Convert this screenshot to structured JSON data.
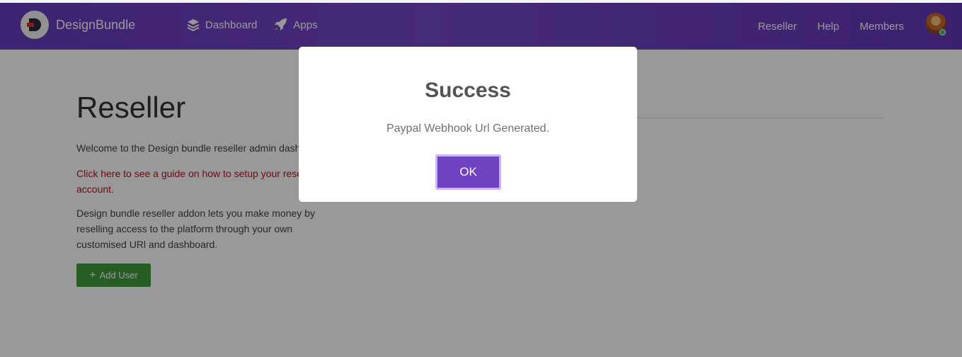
{
  "brand": {
    "name": "DesignBundle"
  },
  "nav": {
    "left": [
      {
        "label": "Dashboard",
        "icon": "layers-icon"
      },
      {
        "label": "Apps",
        "icon": "rocket-icon"
      }
    ],
    "right": [
      "Reseller",
      "Help",
      "Members"
    ]
  },
  "page": {
    "title": "Reseller",
    "welcome": "Welcome to the Design bundle reseller admin dash",
    "guide_link": "Click here to see a guide on how to setup your rese account.",
    "description": "Design bundle reseller addon lets you make money by reselling access to the platform through your own customised URl and dashboard.",
    "add_user_label": "Add User",
    "add_user_icon": "+"
  },
  "modal": {
    "title": "Success",
    "message": "Paypal Webhook Url Generated.",
    "ok_label": "OK"
  },
  "colors": {
    "navbar": "#6a3bc1",
    "accent_button": "#6f42c1",
    "add_user": "#3e9b3e",
    "link": "#c0101a"
  }
}
